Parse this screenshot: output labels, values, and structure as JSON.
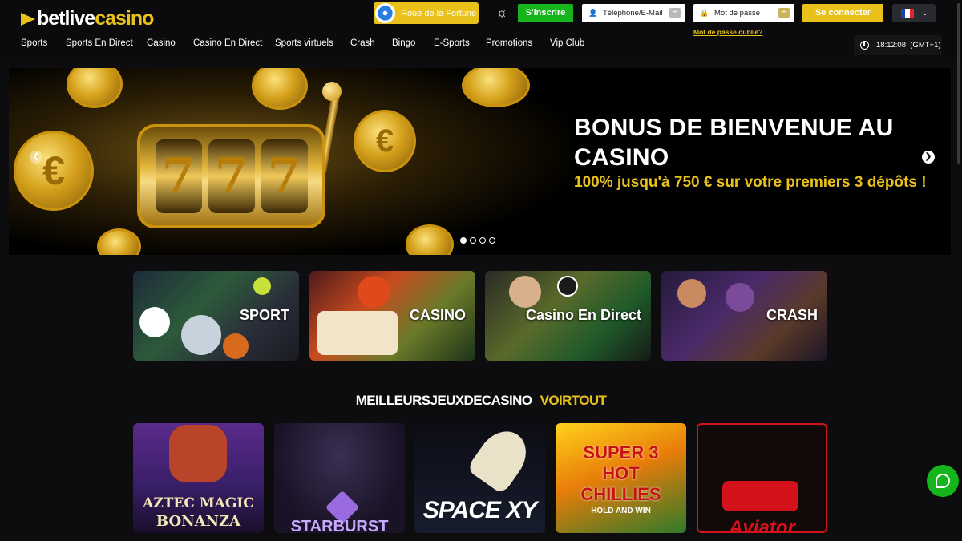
{
  "brand": {
    "logo_part1": "betlive",
    "logo_part2": "casino",
    "accent": "#e8c21a",
    "green": "#16b51c"
  },
  "header": {
    "wheel_label": "Roue de la Fortune",
    "signup_label": "S'inscrire",
    "phone_placeholder": "Téléphone/E-Mail",
    "password_placeholder": "Mot de passe",
    "forgot_label": "Mot de passe oublié?",
    "login_label": "Se connecter",
    "language": "fr"
  },
  "nav": {
    "items": [
      "Sports",
      "Sports En Direct",
      "Casino",
      "Casino En Direct",
      "Sports virtuels",
      "Crash",
      "Bingo",
      "E-Sports",
      "Promotions",
      "Vip Club"
    ]
  },
  "clock": {
    "time": "18:12:08",
    "timezone": "(GMT+1)"
  },
  "hero": {
    "title": "BONUS DE BIENVENUE AU CASINO",
    "subtitle": "100% jusqu'à 750 € sur votre premiers 3 dépôts !",
    "slot_symbols": [
      "7",
      "7",
      "7"
    ],
    "slide_count": 4,
    "active_slide": 1
  },
  "categories": [
    {
      "label": "SPORT"
    },
    {
      "label": "CASINO"
    },
    {
      "label": "Casino En Direct"
    },
    {
      "label": "CRASH"
    }
  ],
  "top_games": {
    "heading": "MEILLEURSJEUXDECASINO",
    "see_all": "VOIRTOUT",
    "games": [
      {
        "line1": "AZTEC MAGIC",
        "line2": "BONANZA"
      },
      {
        "line1": "STARBURST",
        "line2": ""
      },
      {
        "line1": "SPACE XY",
        "line2": ""
      },
      {
        "line1": "SUPER 3 HOT CHILLIES",
        "line2": "HOLD AND WIN"
      },
      {
        "line1": "Aviator",
        "line2": ""
      }
    ]
  }
}
